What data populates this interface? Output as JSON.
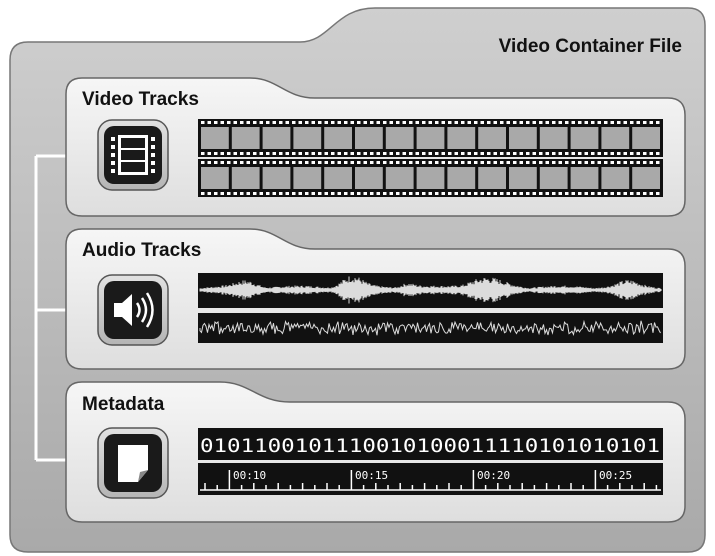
{
  "container": {
    "title": "Video Container File"
  },
  "panels": {
    "video": {
      "title": "Video Tracks",
      "icon": "film-strip-icon",
      "track_count": 2
    },
    "audio": {
      "title": "Audio Tracks",
      "icon": "speaker-icon",
      "track_count": 2
    },
    "metadata": {
      "title": "Metadata",
      "icon": "document-icon",
      "binary": "0101100101110010100011110101010101",
      "timeline_labels": [
        "00:10",
        "00:15",
        "00:20",
        "00:25"
      ]
    }
  },
  "colors": {
    "outer_fill": "#bdbdbd",
    "panel_fill": "#eeeeee",
    "dark": "#111111",
    "film_frame": "#aaaaaa",
    "connector": "#ffffff"
  }
}
